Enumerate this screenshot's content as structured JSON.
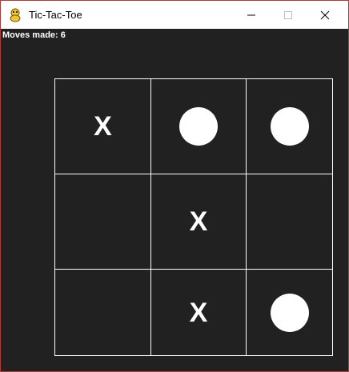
{
  "window": {
    "title": "Tic-Tac-Toe",
    "icon": "python-snake-icon",
    "controls": [
      "minimize",
      "maximize",
      "close"
    ]
  },
  "status": {
    "moves_text": "Moves made: 6"
  },
  "board": {
    "rows": [
      [
        "X",
        "O",
        "O"
      ],
      [
        "",
        "X",
        ""
      ],
      [
        "",
        "X",
        "O"
      ]
    ]
  },
  "colors": {
    "background": "#212121",
    "lines": "#ffffff",
    "marks": "#ffffff",
    "window_border": "#b03a3a"
  }
}
